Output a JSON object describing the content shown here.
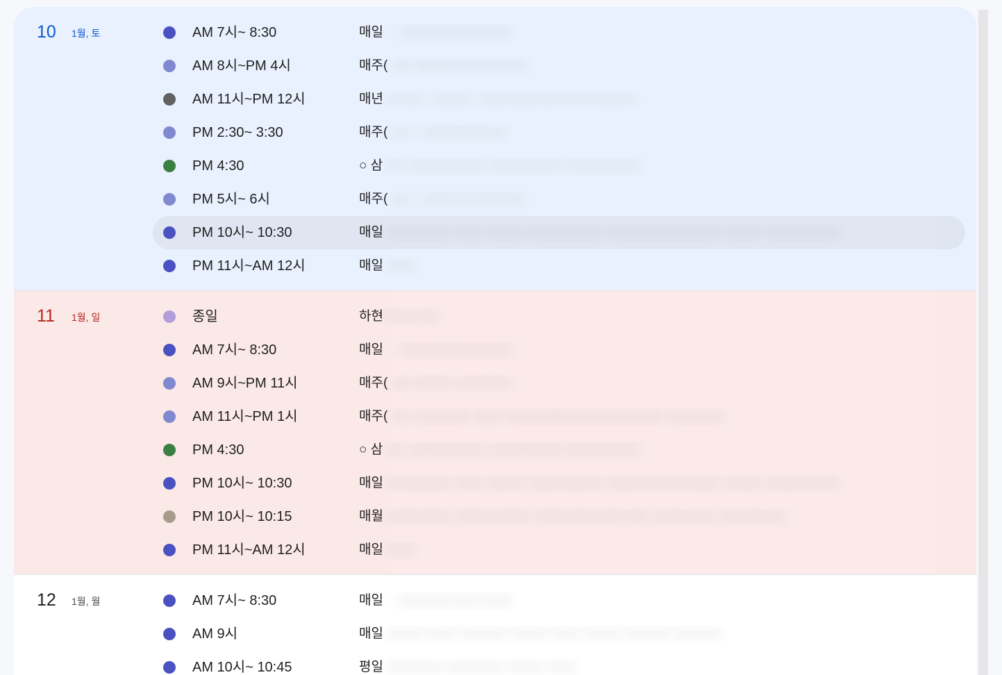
{
  "colors": {
    "blueberry": "#4a52c2",
    "lavender": "#8088cf",
    "graphite": "#616161",
    "basil": "#3a8043",
    "wisteria": "#b39ddb",
    "birch": "#a79b8e",
    "today_accent": "#0b57d0",
    "sunday_accent": "#b3261e",
    "highlight_row": "#dfe6f1"
  },
  "days": [
    {
      "date_number": "10",
      "date_sub": "1월, 토",
      "events": [
        {
          "color": "#4a52c2",
          "time": "AM 7시~ 8:30",
          "title": "매일",
          "title_rest": "·· ░░░░░░░░░░░░"
        },
        {
          "color": "#8088cf",
          "time": "AM 8시~PM 4시",
          "title": "매주(",
          "title_rest": "░░·░░░░░░░░░░░░"
        },
        {
          "color": "#616161",
          "time": "AM 11시~PM 12시",
          "title": "매년",
          "title_rest": "░░░░ ·░░░░· ░░░░░░░░░░░░░░░░░"
        },
        {
          "color": "#8088cf",
          "time": "PM 2:30~ 3:30",
          "title": "매주(",
          "title_rest": "░░ · ░░░░░░░░░"
        },
        {
          "color": "#3a8043",
          "time": "PM 4:30",
          "title": "○ 삼",
          "title_rest": "░░ ░░░░░░░░ ░░░░░░░░ ░░░░░░░░"
        },
        {
          "color": "#8088cf",
          "time": "PM 5시~ 6시",
          "title": "매주(",
          "title_rest": "░░ · ░░░░░░░░░░░"
        },
        {
          "color": "#4a52c2",
          "time": "PM 10시~ 10:30",
          "title": "매일",
          "title_rest": "░░░░░░░ ░░░ ░░░░ ░░░░░░░░ ░░░░░░░░░░░░ ░░░░ ░░░░░░░░",
          "highlight": true
        },
        {
          "color": "#4a52c2",
          "time": "PM 11시~AM 12시",
          "title": "매일",
          "title_rest": "░░░"
        }
      ]
    },
    {
      "date_number": "11",
      "date_sub": "1월, 일",
      "events": [
        {
          "color": "#b39ddb",
          "time": "종일",
          "title": "하현",
          "title_rest": "░░░░░░"
        },
        {
          "color": "#4a52c2",
          "time": "AM 7시~ 8:30",
          "title": "매일",
          "title_rest": "·· ░░░░░░░░░░░░"
        },
        {
          "color": "#8088cf",
          "time": "AM 9시~PM 11시",
          "title": "매주(",
          "title_rest": "░░ ░░░░ ░░░░░░"
        },
        {
          "color": "#8088cf",
          "time": "AM 11시~PM 1시",
          "title": "매주(",
          "title_rest": "░░ ░░░░░░ ░░░ ░░░░░░░░░░░░░░░░░ ░░░░░░"
        },
        {
          "color": "#3a8043",
          "time": "PM 4:30",
          "title": "○ 삼",
          "title_rest": "░░ ░░░░░░░░ ░░░░░░░░ ░░░░░░░░"
        },
        {
          "color": "#4a52c2",
          "time": "PM 10시~ 10:30",
          "title": "매일",
          "title_rest": "░░░░░░░ ░░░ ░░░░ ░░░░░░░░ ░░░░░░░░░░░░ ░░░░ ░░░░░░░░"
        },
        {
          "color": "#a79b8e",
          "time": "PM 10시~ 10:15",
          "title": "매월",
          "title_rest": "░░░░░░░ ░░░░░░░░ ░░░░░░░░░░░░ ░░░░░░░ ░░░░░░░"
        },
        {
          "color": "#4a52c2",
          "time": "PM 11시~AM 12시",
          "title": "매일",
          "title_rest": "░░░"
        }
      ]
    },
    {
      "date_number": "12",
      "date_sub": "1월, 월",
      "events": [
        {
          "color": "#4a52c2",
          "time": "AM 7시~ 8:30",
          "title": "매일",
          "title_rest": "·· ░░░░░░░░░░░░"
        },
        {
          "color": "#4a52c2",
          "time": "AM 9시",
          "title": "매일",
          "title_rest": "░░░░ ░░░ ░░░░░ ░░░░ ░░░ ░░░░ ░░░░░ ░░░░░"
        },
        {
          "color": "#4a52c2",
          "time": "AM 10시~ 10:45",
          "title": "평일",
          "title_rest": "░░░░░░ ░░░░░░ ░░░░ ░░░"
        }
      ]
    }
  ]
}
